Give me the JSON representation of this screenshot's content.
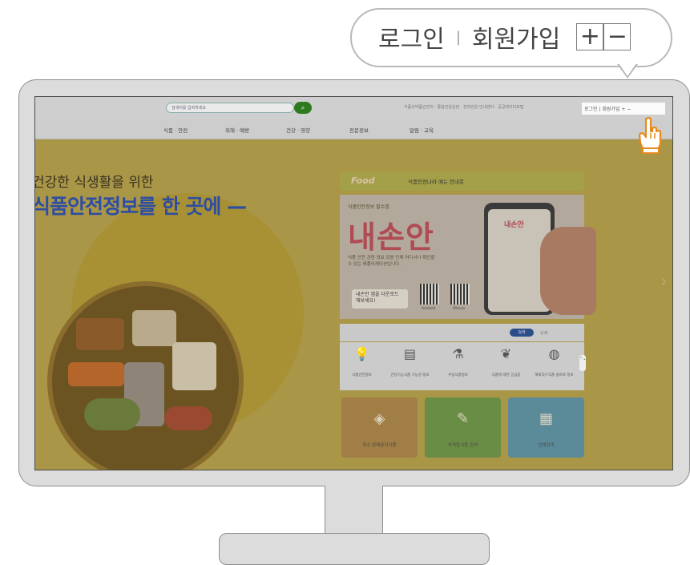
{
  "callout": {
    "login": "로그인",
    "separator": "|",
    "signup": "회원가입",
    "zoom_in": "+",
    "zoom_out": "−"
  },
  "site": {
    "search_placeholder": "검색어를 입력하세요",
    "top_links": "식품의약품안전처 · 통합민원상담 · 전자민원 안내센터 · 공공데이터포털",
    "top_login": "로그인 | 회원가입  + −",
    "nav": [
      "식품 · 안전",
      "위해 · 예방",
      "건강 · 영양",
      "전문정보",
      "알림 · 교육"
    ],
    "slogan_line1": "건강한 식생활을 위한",
    "slogan_line2": "식품안전정보를 한 곳에",
    "banner_logo": "Food",
    "banner_text": "식품안전나라 메뉴 안내봇",
    "app_small": "식품안전정보 필수앱",
    "app_title": "내손안",
    "app_desc": "식품 안전 관련 정보 모음 언제 어디서나 확인할 수 있는 애플리케이션입니다.",
    "app_button": "내손안 앱을 다운로드 해보세요!",
    "qr_labels": [
      "Android",
      "iPhone"
    ],
    "search_pill": "검색",
    "search_label": "상세",
    "quick_icons": [
      {
        "icon": "lightbulb-icon",
        "glyph": "💡",
        "label": "식품안전정보"
      },
      {
        "icon": "document-icon",
        "glyph": "▤",
        "label": "건강기능식품 기능성 정보"
      },
      {
        "icon": "flask-icon",
        "glyph": "⚗",
        "label": "수입식품정보"
      },
      {
        "icon": "leaf-icon",
        "glyph": "❦",
        "label": "식품에 대한 궁금증"
      },
      {
        "icon": "globe-icon",
        "glyph": "◍",
        "label": "해외직구식품 올바로 정보"
      }
    ],
    "tiles": [
      {
        "label": "회수·판매중지식품",
        "color": "#a07e45",
        "glyph": "◈"
      },
      {
        "label": "부적합식품 검색",
        "color": "#6a8d45",
        "glyph": "✎"
      },
      {
        "label": "업체검색",
        "color": "#5b8a99",
        "glyph": "▦"
      }
    ]
  },
  "colors": {
    "screen_overlay": "#a99647",
    "pointer": "#e88a1a",
    "monitor": "#dcdcdc"
  }
}
